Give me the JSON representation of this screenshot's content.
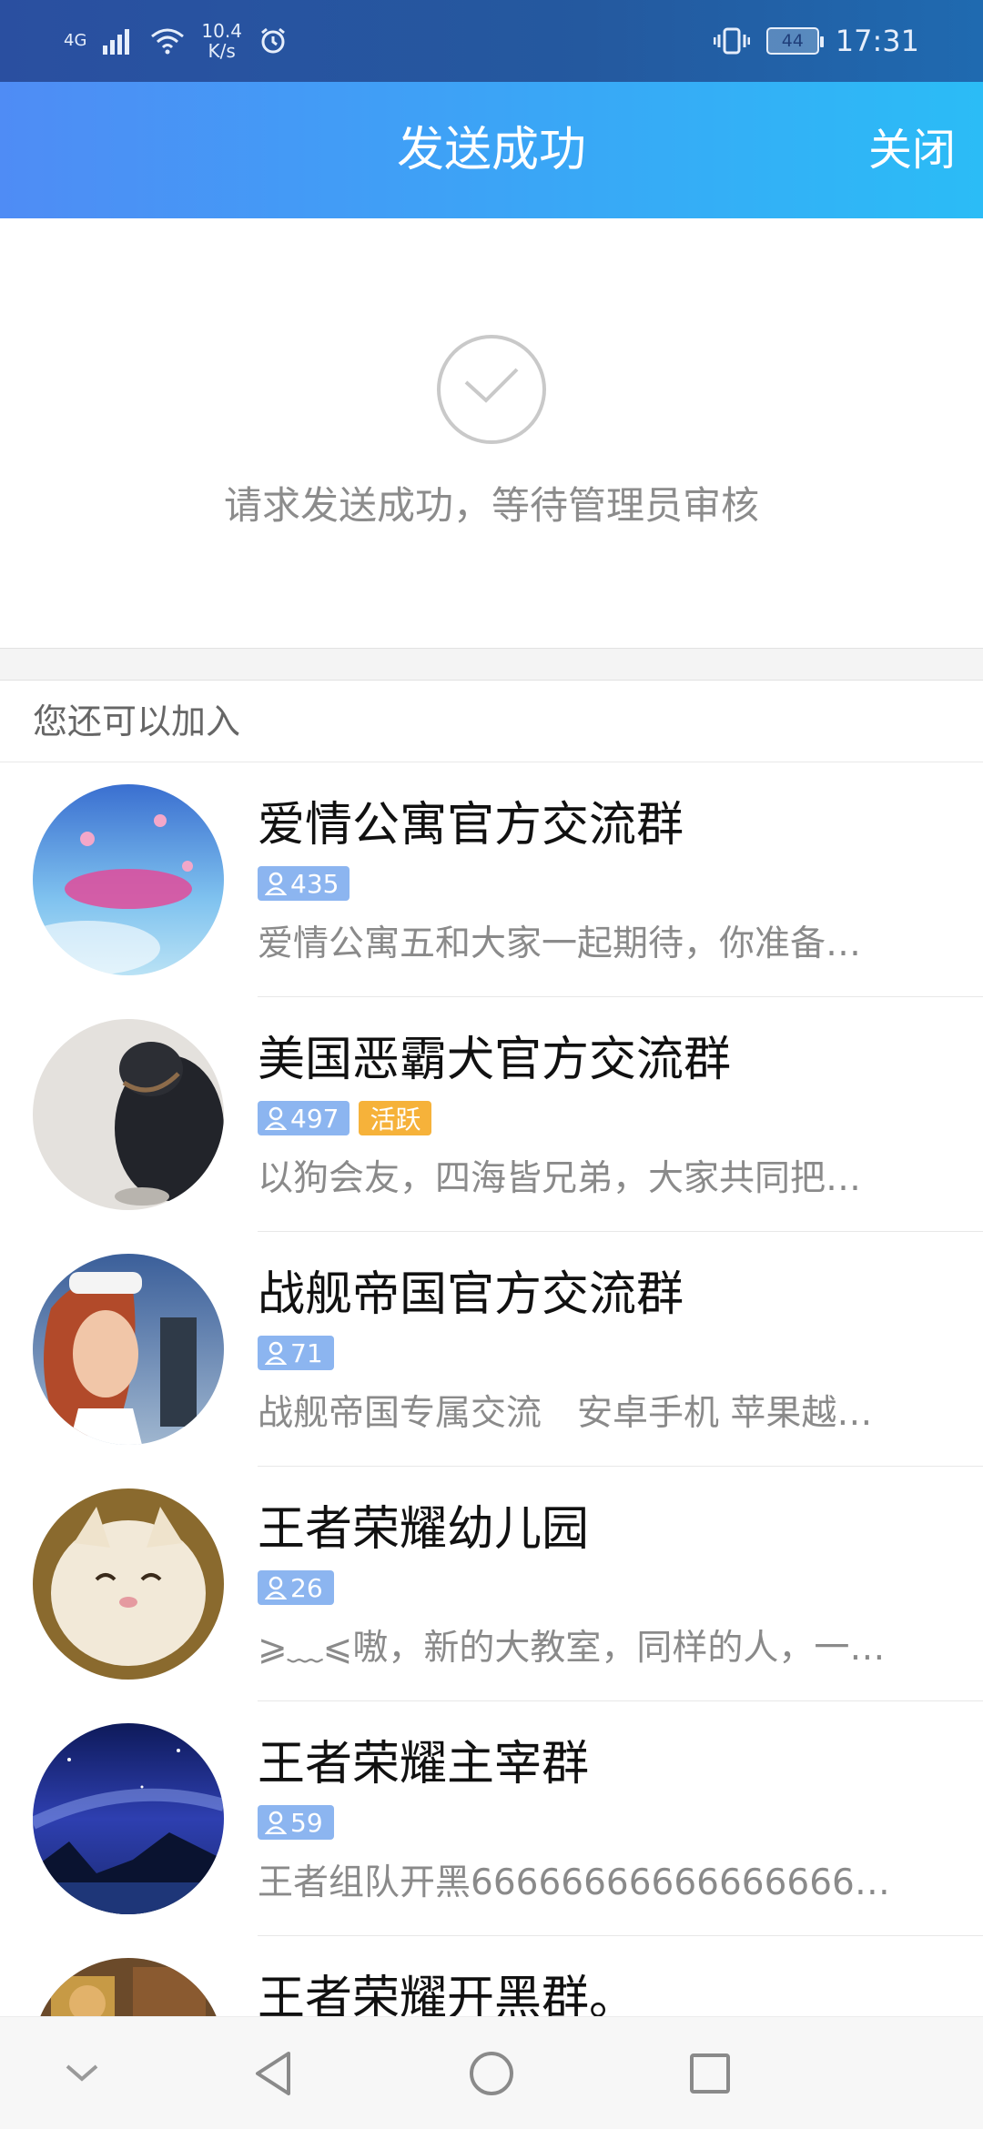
{
  "status_bar": {
    "network": "4G",
    "speed_value": "10.4",
    "speed_unit": "K/s",
    "battery": "44",
    "time": "17:31"
  },
  "header": {
    "title": "发送成功",
    "close_label": "关闭"
  },
  "success": {
    "message": "请求发送成功，等待管理员审核"
  },
  "section": {
    "title": "您还可以加入"
  },
  "groups": [
    {
      "name": "爱情公寓官方交流群",
      "members": "435",
      "active": "",
      "desc": "爱情公寓五和大家一起期待，你准备…"
    },
    {
      "name": "美国恶霸犬官方交流群",
      "members": "497",
      "active": "活跃",
      "desc": "以狗会友，四海皆兄弟，大家共同把…"
    },
    {
      "name": "战舰帝国官方交流群",
      "members": "71",
      "active": "",
      "desc": "战舰帝国专属交流　安卓手机 苹果越…"
    },
    {
      "name": "王者荣耀幼儿园",
      "members": "26",
      "active": "",
      "desc": "⩾﹏⩽嗷，新的大教室，同样的人，一…"
    },
    {
      "name": "王者荣耀主宰群",
      "members": "59",
      "active": "",
      "desc": "王者组队开黑66666666666666666…"
    },
    {
      "name": "王者荣耀开黑群。",
      "members": "",
      "active": "",
      "desc": ""
    }
  ],
  "colors": {
    "accent_blue": "#4f8cf5",
    "badge_blue": "#8cb5f0",
    "badge_orange": "#f6b23a"
  },
  "icons": {
    "check": "check-icon",
    "member": "user-icon",
    "back": "back-triangle-icon",
    "home": "home-circle-icon",
    "recents": "recents-square-icon",
    "collapse": "chevron-down-icon"
  }
}
